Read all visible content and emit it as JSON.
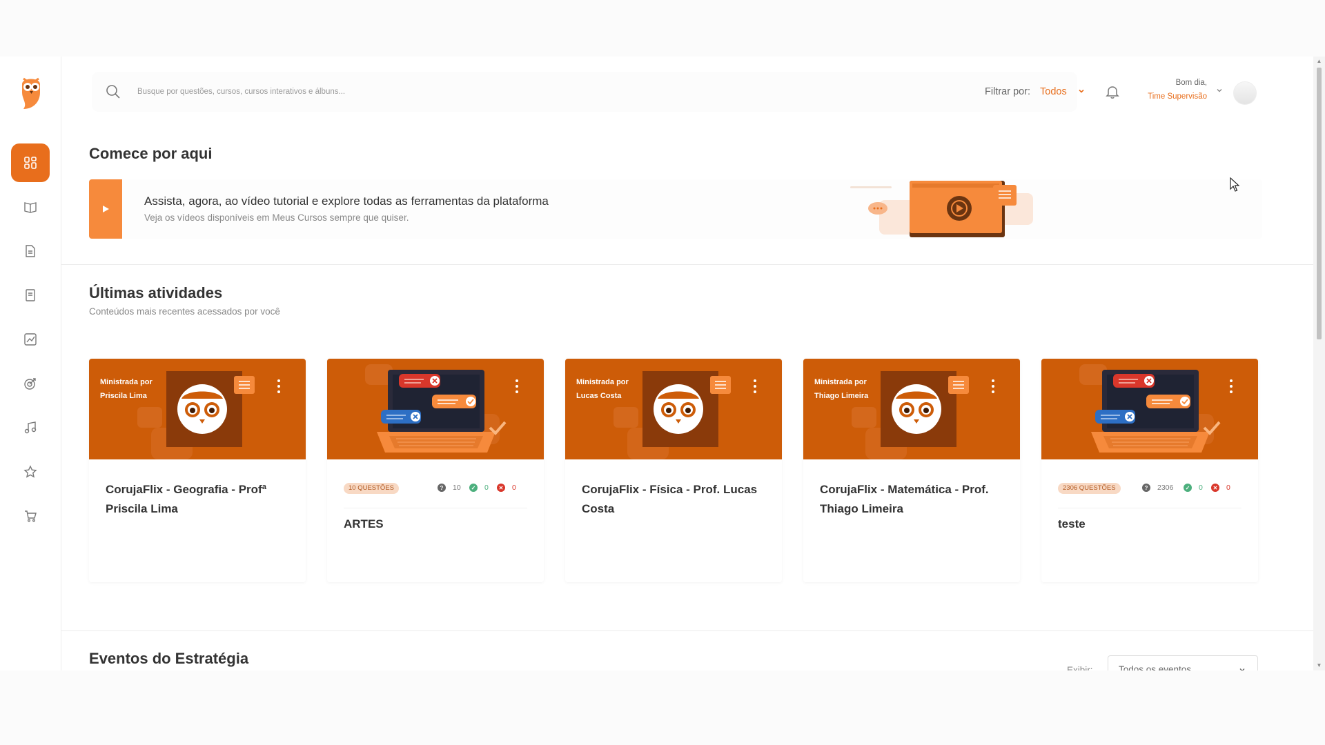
{
  "header": {
    "search_placeholder": "Busque por questões, cursos, cursos interativos e álbuns...",
    "filter_label": "Filtrar por:",
    "filter_value": "Todos",
    "greeting": "Bom dia,",
    "username": "Time Supervisão"
  },
  "sidebar": {
    "items": [
      {
        "name": "dashboard-icon",
        "active": true
      },
      {
        "name": "book-icon"
      },
      {
        "name": "document-icon"
      },
      {
        "name": "notebook-icon"
      },
      {
        "name": "chart-icon"
      },
      {
        "name": "target-icon"
      },
      {
        "name": "music-icon"
      },
      {
        "name": "star-icon"
      },
      {
        "name": "cart-icon"
      }
    ]
  },
  "start": {
    "title": "Comece por aqui",
    "banner_title": "Assista, agora, ao vídeo tutorial e explore todas as ferramentas da plataforma",
    "banner_subtitle": "Veja os vídeos disponíveis em Meus Cursos sempre que quiser."
  },
  "activities": {
    "title": "Últimas atividades",
    "subtitle": "Conteúdos mais recentes acessados por você",
    "cards": [
      {
        "type": "course",
        "teacher_prefix": "Ministrada por",
        "teacher": "Priscila Lima",
        "title": "CorujaFlix - Geografia - Profª Priscila Lima"
      },
      {
        "type": "quiz",
        "badge": "10 QUESTÕES",
        "total": "10",
        "correct": "0",
        "wrong": "0",
        "title": "ARTES"
      },
      {
        "type": "course",
        "teacher_prefix": "Ministrada por",
        "teacher": "Lucas Costa",
        "title": "CorujaFlix - Física - Prof. Lucas Costa"
      },
      {
        "type": "course",
        "teacher_prefix": "Ministrada por",
        "teacher": "Thiago Limeira",
        "title": "CorujaFlix - Matemática - Prof. Thiago Limeira"
      },
      {
        "type": "quiz",
        "badge": "2306 QUESTÕES",
        "total": "2306",
        "correct": "0",
        "wrong": "0",
        "title": "teste"
      }
    ]
  },
  "events": {
    "title": "Eventos do Estratégia",
    "exibir_label": "Exibir:",
    "select_value": "Todos os eventos"
  },
  "colors": {
    "accent": "#e86e1c",
    "card_head": "#cd5c08",
    "correct": "#4caf7d",
    "wrong": "#d9372b",
    "blue": "#2d6fc4"
  }
}
